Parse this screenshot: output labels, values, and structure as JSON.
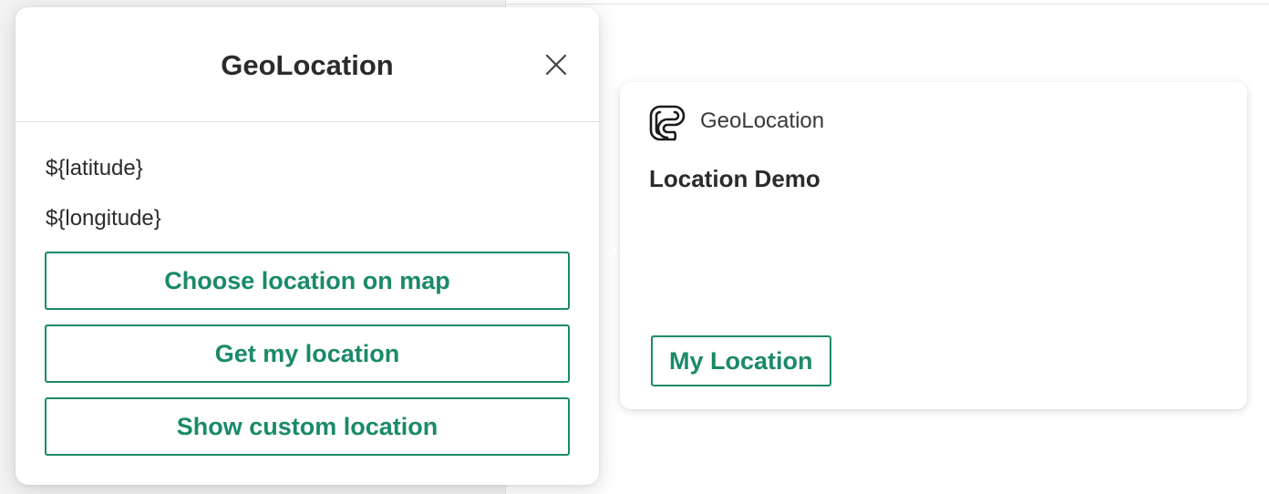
{
  "dialog": {
    "title": "GeoLocation",
    "latitude_text": "${latitude}",
    "longitude_text": "${longitude}",
    "buttons": {
      "choose_on_map": "Choose location on map",
      "get_my_location": "Get my location",
      "show_custom_location": "Show custom location"
    },
    "close_icon": "close-icon"
  },
  "card": {
    "app_name": "GeoLocation",
    "app_icon": "app-logo-icon",
    "title": "Location Demo",
    "button_label": "My Location"
  },
  "colors": {
    "accent": "#1a8a68",
    "text": "#2b2b2b",
    "background": "#ffffff"
  }
}
